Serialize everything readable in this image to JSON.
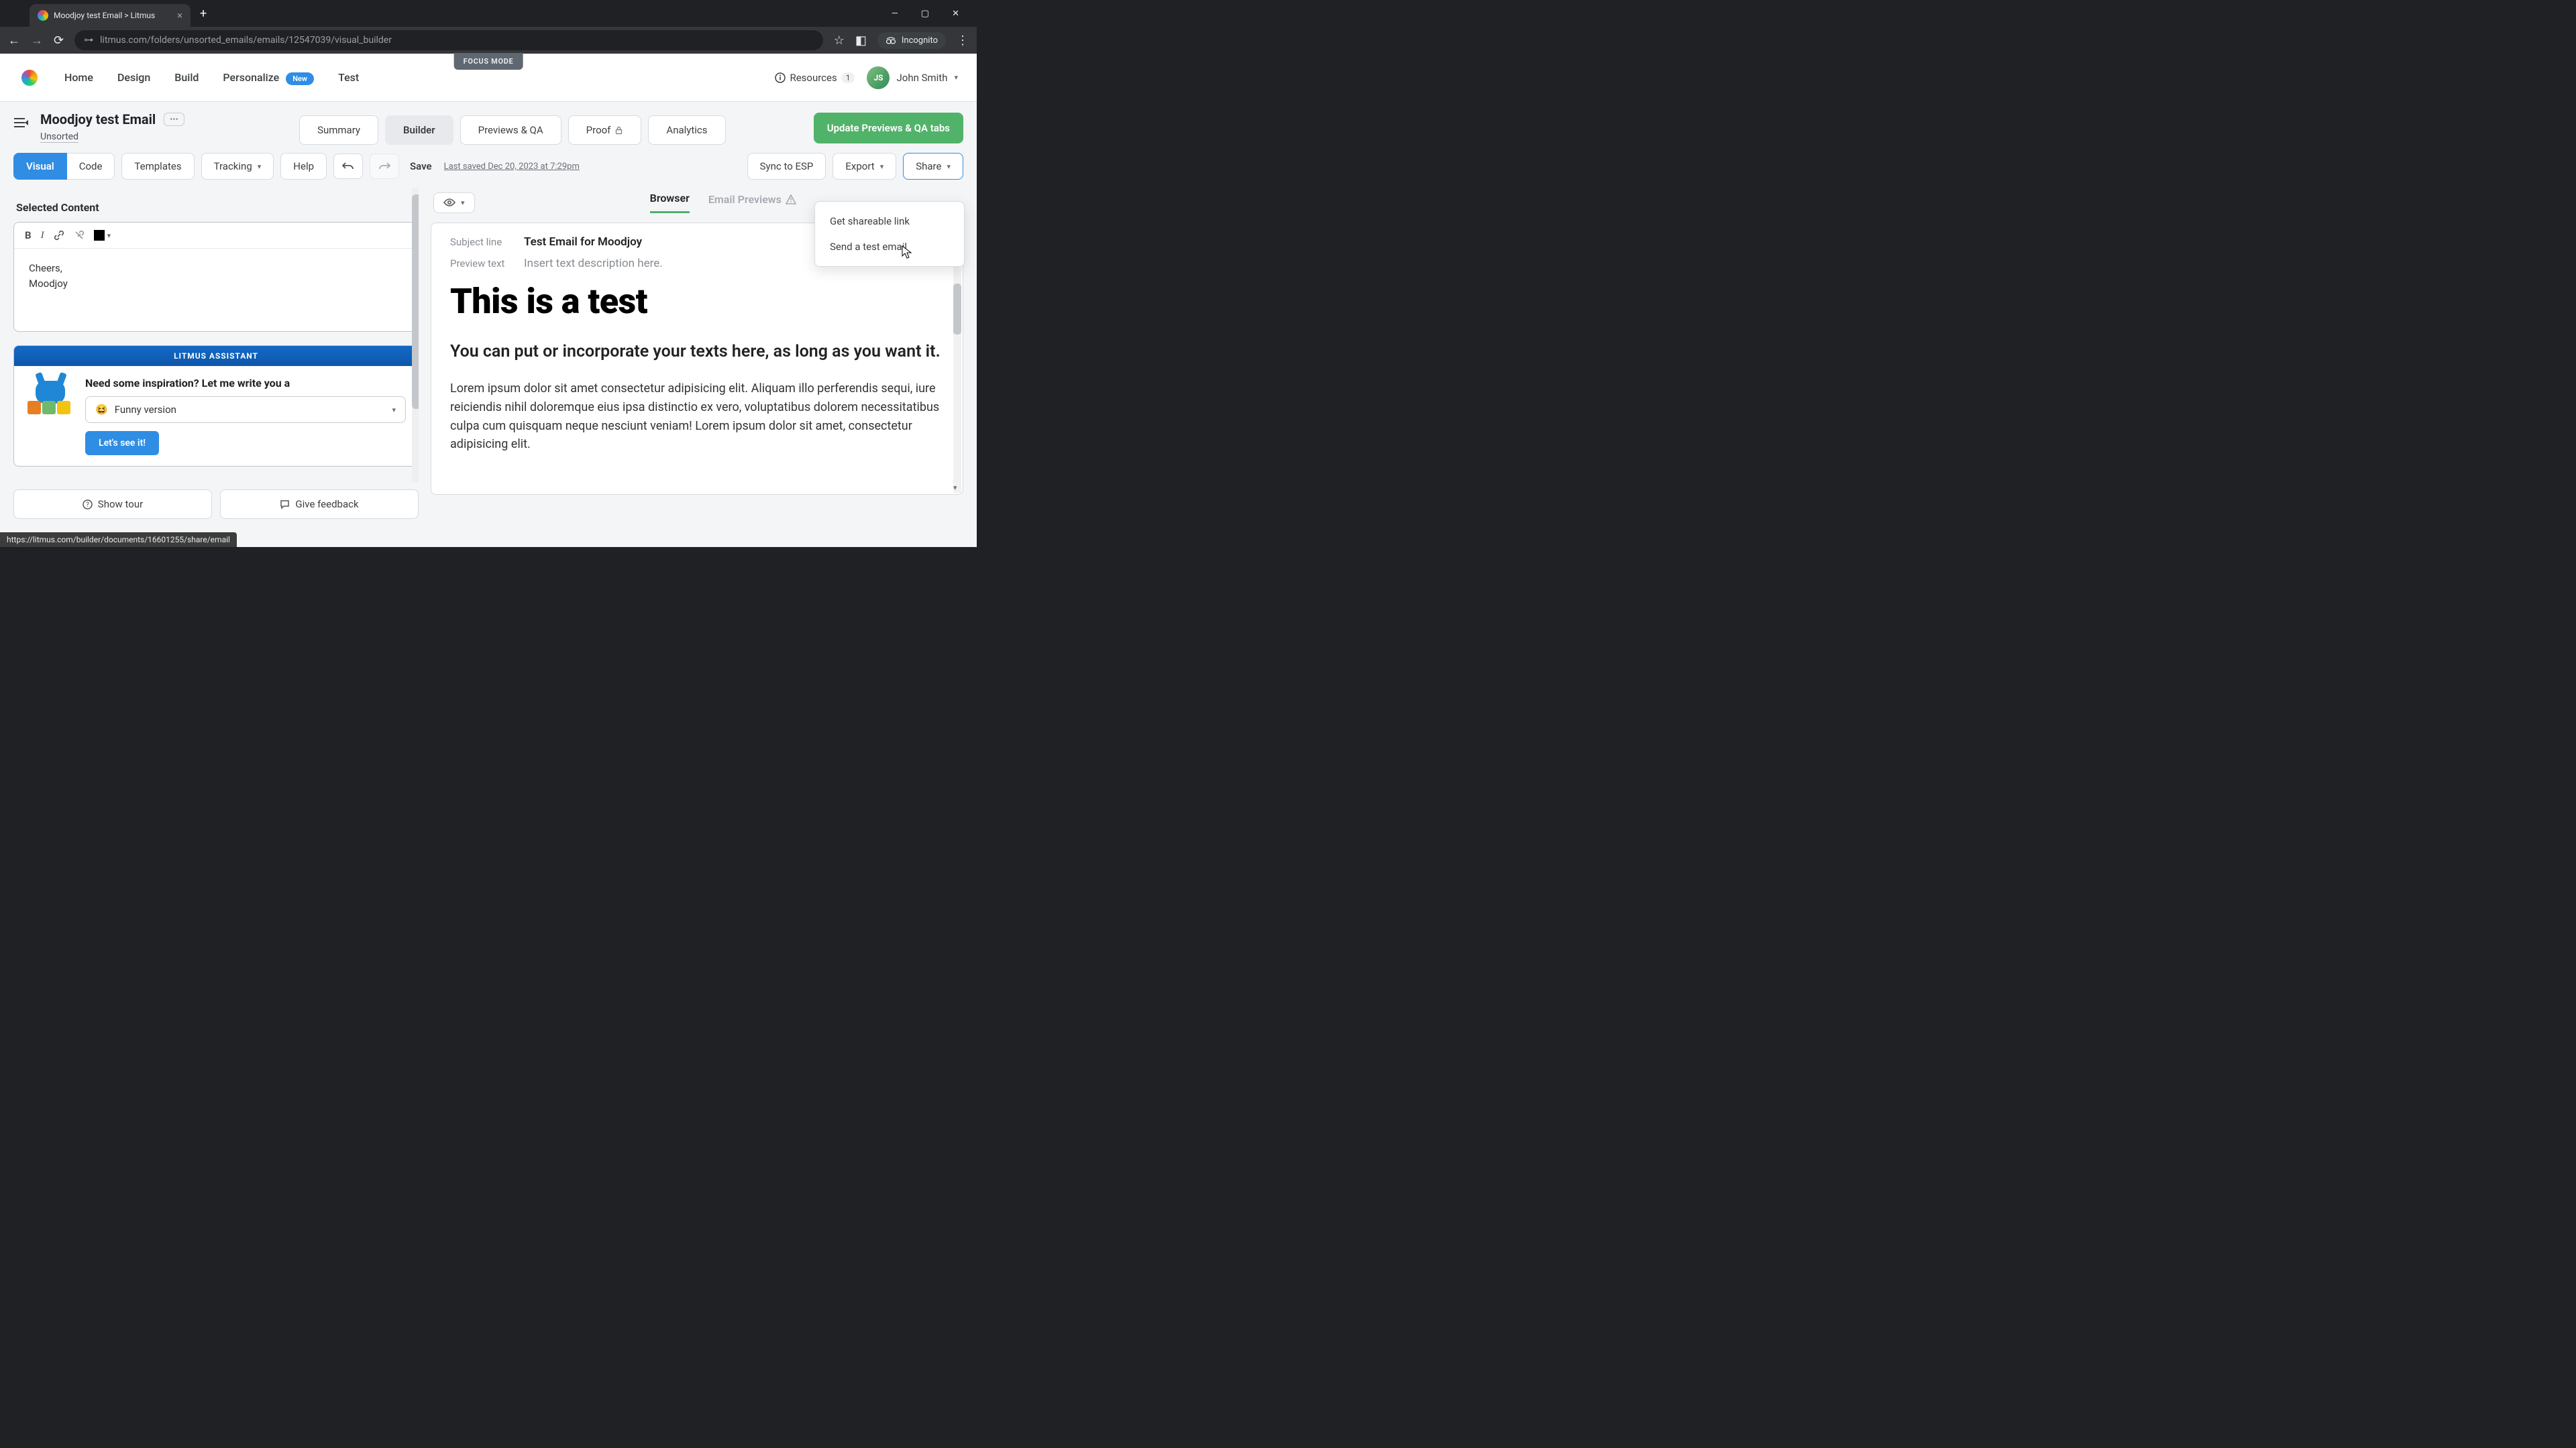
{
  "browser": {
    "tab_title": "Moodjoy test Email > Litmus",
    "url": "litmus.com/folders/unsorted_emails/emails/12547039/visual_builder",
    "incognito": "Incognito",
    "status_url": "https://litmus.com/builder/documents/16601255/share/email"
  },
  "topnav": {
    "links": [
      "Home",
      "Design",
      "Build",
      "Personalize",
      "Test"
    ],
    "new_badge": "New",
    "focus_mode": "FOCUS MODE",
    "resources": "Resources",
    "resources_count": "1",
    "user_name": "John Smith"
  },
  "doc": {
    "title": "Moodjoy test Email",
    "folder": "Unsorted",
    "tabs": [
      "Summary",
      "Builder",
      "Previews & QA",
      "Proof",
      "Analytics"
    ],
    "active_tab": "Builder",
    "update_btn": "Update Previews & QA tabs"
  },
  "toolbar": {
    "visual": "Visual",
    "code": "Code",
    "templates": "Templates",
    "tracking": "Tracking",
    "help": "Help",
    "save": "Save",
    "last_saved": "Last saved Dec 20, 2023 at 7:29pm",
    "sync": "Sync to ESP",
    "export": "Export",
    "share": "Share"
  },
  "share_menu": {
    "link": "Get shareable link",
    "send": "Send a test email"
  },
  "editor": {
    "selected_heading": "Selected Content",
    "body_line1": "Cheers,",
    "body_line2": "Moodjoy"
  },
  "assistant": {
    "header": "LITMUS ASSISTANT",
    "question": "Need some inspiration? Let me write you a",
    "option": "Funny version",
    "emoji": "😆",
    "cta": "Let's see it!"
  },
  "footer": {
    "show_tour": "Show tour",
    "feedback": "Give feedback"
  },
  "preview": {
    "tabs_browser": "Browser",
    "tabs_email": "Email Previews",
    "subject_label": "Subject line",
    "subject_value": "Test Email for Moodjoy",
    "preview_label": "Preview text",
    "preview_value": "Insert text description here.",
    "h1": "This is a test",
    "sub": "You can put or incorporate your texts here, as long as you want it.",
    "para": "Lorem ipsum dolor sit amet consectetur adipisicing elit. Aliquam illo perferendis sequi, iure reiciendis nihil doloremque eius ipsa distinctio ex vero, voluptatibus dolorem necessitatibus culpa cum quisquam neque nesciunt veniam! Lorem ipsum dolor sit amet, consectetur adipisicing elit."
  }
}
